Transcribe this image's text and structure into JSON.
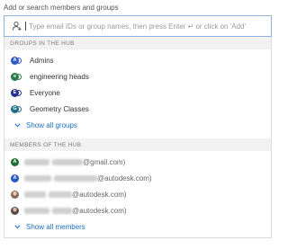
{
  "field_label": "Add or search members and groups",
  "search": {
    "placeholder": "Type email IDs or group names, then press Enter ↵ or click on 'Add'"
  },
  "groups_section": {
    "heading": "GROUPS IN THE HUB",
    "items": [
      {
        "label": "Admins",
        "initial": "A",
        "color": "#2b57c8"
      },
      {
        "label": "engineering heads",
        "initial": "e",
        "color": "#2c7a4a"
      },
      {
        "label": "Everyone",
        "initial": "E",
        "color": "#2a2f8a"
      },
      {
        "label": "Geometry Classes",
        "initial": "G",
        "color": "#1f6f86"
      }
    ],
    "show_all": "Show all groups"
  },
  "members_section": {
    "heading": "MEMBERS OF THE HUB",
    "items": [
      {
        "suffix": "@gmail.com)",
        "initial": "A",
        "color": "#1f6e37",
        "avatar": "letter"
      },
      {
        "suffix": "@autodesk.com)",
        "initial": "A",
        "color": "#2b57c8",
        "avatar": "letter"
      },
      {
        "suffix": "@autodesk.com)",
        "initial": "",
        "color": "#8a6a5a",
        "avatar": "photo"
      },
      {
        "suffix": "@autodesk.com)",
        "initial": "",
        "color": "#5a4a48",
        "avatar": "photo"
      }
    ],
    "show_all": "Show all members"
  },
  "colors": {
    "accent": "#1a6fc2",
    "search_border": "#8fb4e0",
    "section_bg": "#f2f2f2"
  }
}
